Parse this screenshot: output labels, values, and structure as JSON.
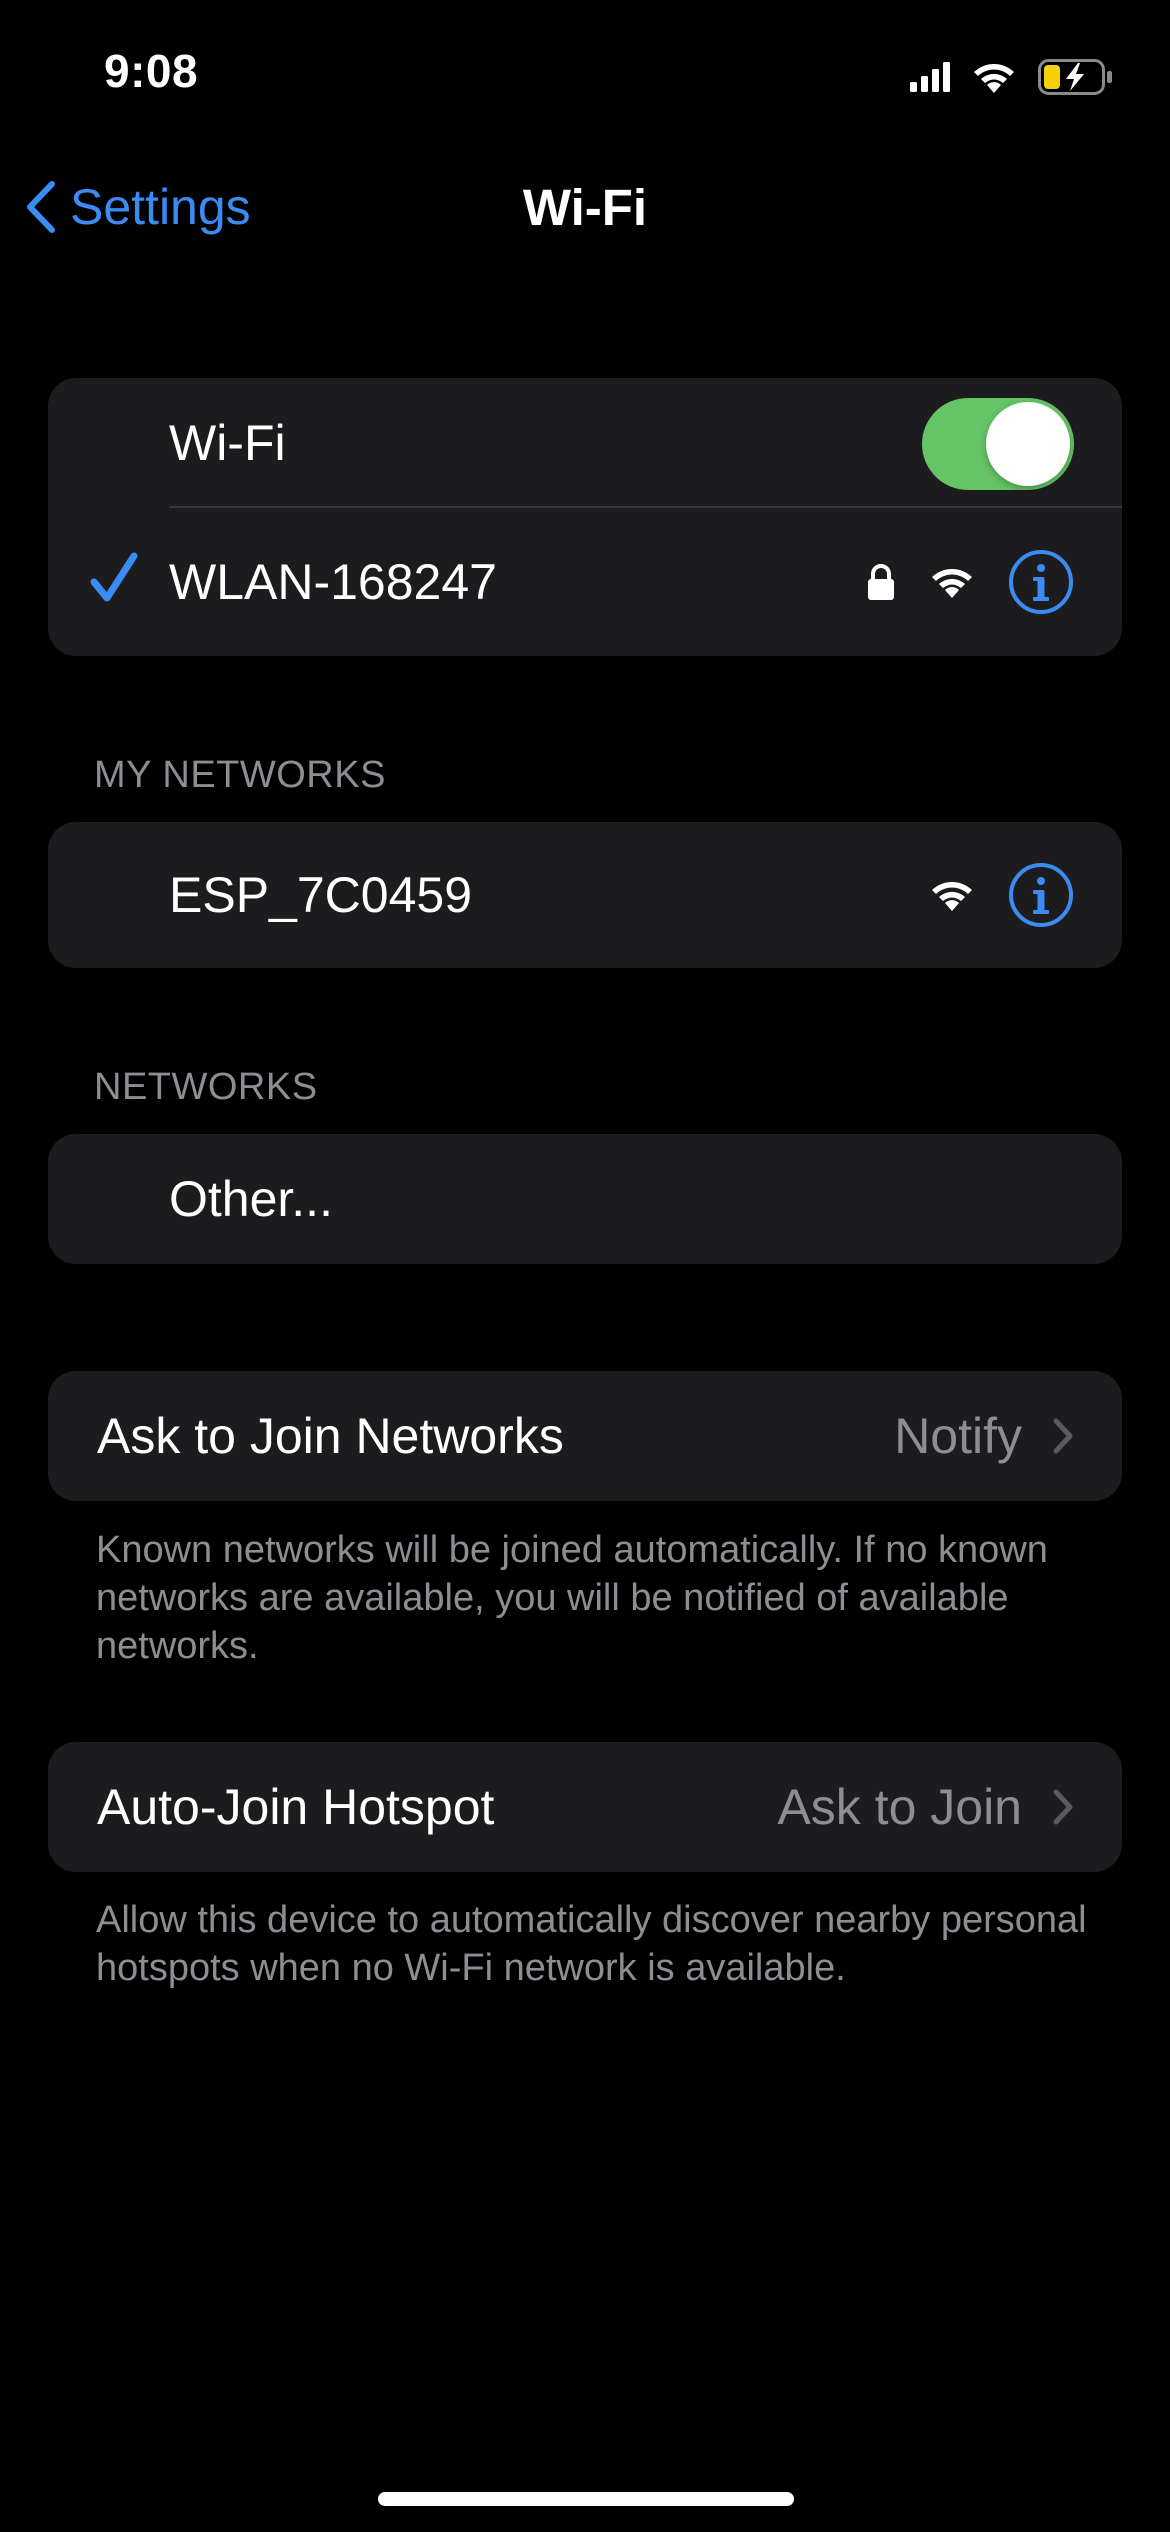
{
  "status_bar": {
    "time": "9:08",
    "signal_icon": "cellular-signal-icon",
    "wifi_icon": "wifi-icon",
    "battery_icon": "battery-charging-icon",
    "battery_color": "#f5d10b"
  },
  "nav": {
    "back_label": "Settings",
    "title": "Wi-Fi",
    "accent_color": "#3a8cf3"
  },
  "wifi_group": {
    "toggle_label": "Wi-Fi",
    "toggle_on": true,
    "toggle_color": "#65c466",
    "connected_network": {
      "name": "WLAN-168247",
      "secured": true,
      "icons": [
        "checkmark-icon",
        "lock-icon",
        "wifi-icon",
        "info-icon"
      ]
    }
  },
  "my_networks": {
    "header": "MY NETWORKS",
    "items": [
      {
        "name": "ESP_7C0459",
        "icons": [
          "wifi-icon",
          "info-icon"
        ]
      }
    ]
  },
  "networks": {
    "header": "NETWORKS",
    "other_label": "Other..."
  },
  "ask_to_join": {
    "label": "Ask to Join Networks",
    "value": "Notify",
    "footer": "Known networks will be joined automatically. If no known networks are available, you will be notified of available networks."
  },
  "auto_join_hotspot": {
    "label": "Auto-Join Hotspot",
    "value": "Ask to Join",
    "footer": "Allow this device to automatically discover nearby personal hotspots when no Wi-Fi network is available."
  }
}
